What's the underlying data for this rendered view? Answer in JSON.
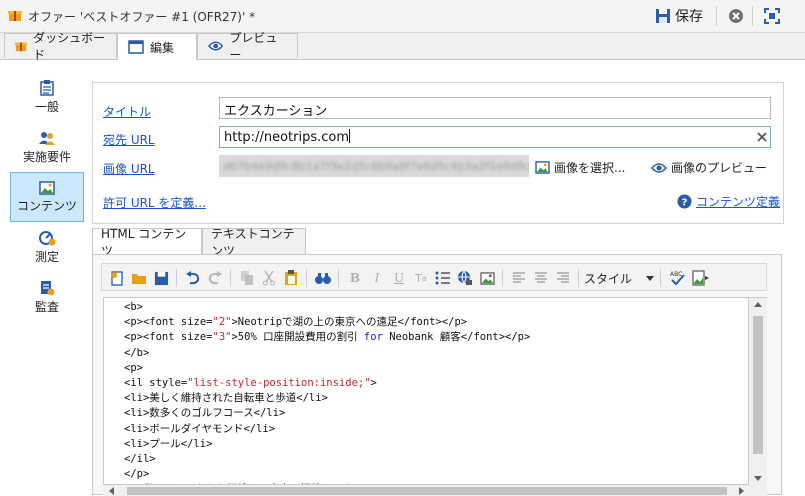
{
  "window": {
    "title": "オファー 'ベストオファー #1 (OFR27)' *",
    "save_label": "保存"
  },
  "tabs": [
    {
      "label": "ダッシュボード"
    },
    {
      "label": "編集"
    },
    {
      "label": "プレビュー"
    }
  ],
  "sidebar": {
    "items": [
      {
        "label": "一般",
        "icon": "document-icon"
      },
      {
        "label": "実施要件",
        "icon": "people-icon"
      },
      {
        "label": "コンテンツ",
        "icon": "image-icon"
      },
      {
        "label": "測定",
        "icon": "gauge-icon"
      },
      {
        "label": "監査",
        "icon": "audit-icon"
      }
    ]
  },
  "form": {
    "title_label": "タイトル",
    "title_value": "エクスカーション",
    "url_label": "宛先 URL",
    "url_value": "http://neotrips.com",
    "image_label": "画像 URL",
    "image_value_blurred": "d67b4e9d9c8b1a7f3e2d5c6b9a8f7e6d5c4b3a2f1e0d9c8b7a",
    "select_image": "画像を選択...",
    "preview_image": "画像のプレビュー",
    "allowed_url": "許可 URL を定義...",
    "content_def": "コンテンツ定義"
  },
  "content_tabs": [
    {
      "label": "HTML コンテンツ"
    },
    {
      "label": "テキストコンテンツ"
    }
  ],
  "editor": {
    "style_label": "スタイル",
    "lines": [
      "<b>",
      "<p><font size=\"2\">Neotripで湖の上の東京への遠足</font></p>",
      "<p><font size=\"3\">50% 口座開設費用の割引 for Neobank 顧客</font></p>",
      "</b>",
      "<p>",
      "<il style=\"list-style-position:inside;\">",
      "<li>美しく維持された自転車と歩道</li>",
      "<li>数多くのゴルフコース</li>",
      "<li>ボールダイヤモンド</li>",
      "<li>プール</li>",
      "</il>",
      "</p>",
      "<p>私たちはあなたを探検し、東京に招待します</p>"
    ]
  },
  "colors": {
    "accent": "#1a56c4",
    "active_nav": "#cce8ff",
    "string": "#c0262c"
  }
}
